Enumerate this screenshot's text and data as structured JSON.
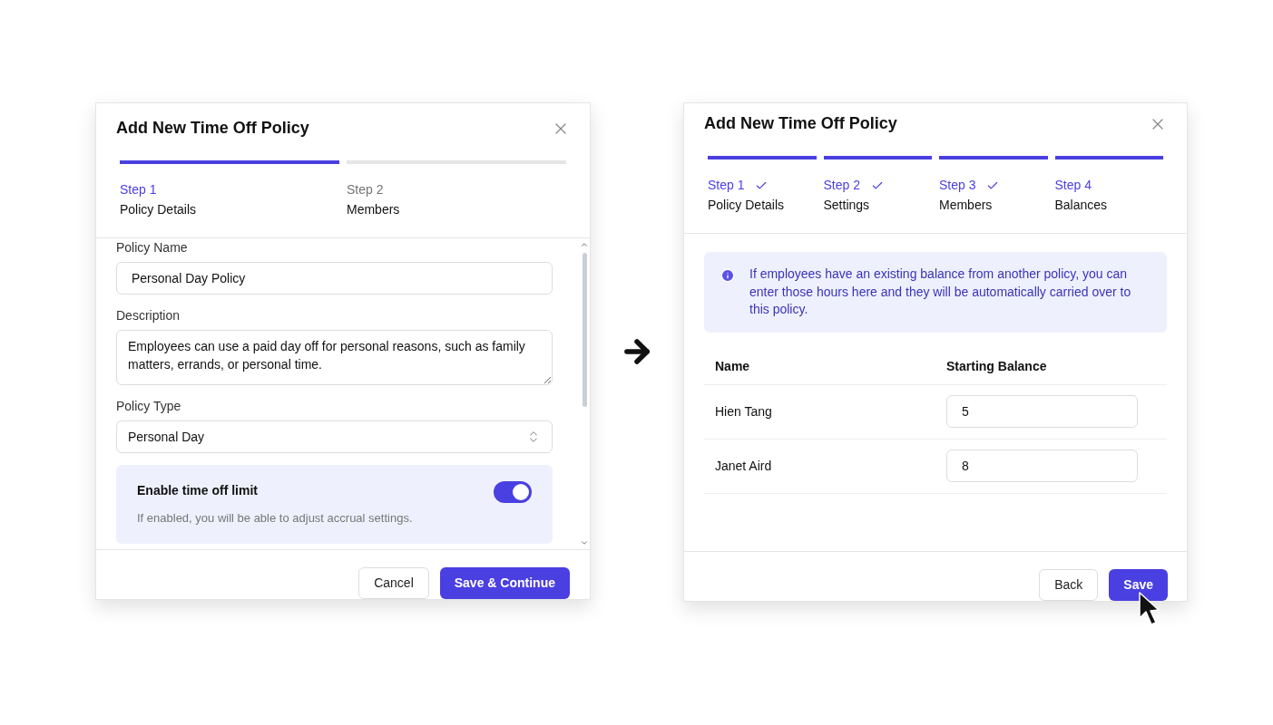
{
  "dialogs": [
    {
      "title": "Add New Time Off Policy",
      "steps": [
        {
          "label": "Step 1",
          "name": "Policy Details",
          "active": true,
          "completed": false
        },
        {
          "label": "Step 2",
          "name": "Members",
          "active": false,
          "completed": false
        }
      ],
      "fields": [
        {
          "kind": "text",
          "label": "Policy Name",
          "value": "Personal Day Policy"
        },
        {
          "kind": "textarea",
          "label": "Description",
          "value": "Employees can use a paid day off for personal reasons, such as family matters, errands, or personal time."
        },
        {
          "kind": "select",
          "label": "Policy Type",
          "value": "Personal Day"
        }
      ],
      "toggle_card": {
        "title": "Enable time off limit",
        "hint": "If enabled, you will be able to adjust accrual settings.",
        "on": true
      },
      "buttons": [
        {
          "kind": "secondary",
          "label": "Cancel"
        },
        {
          "kind": "primary",
          "label": "Save & Continue"
        }
      ]
    },
    {
      "title": "Add New Time Off Policy",
      "steps": [
        {
          "label": "Step 1",
          "name": "Policy Details",
          "active": true,
          "completed": true
        },
        {
          "label": "Step 2",
          "name": "Settings",
          "active": true,
          "completed": true
        },
        {
          "label": "Step 3",
          "name": "Members",
          "active": true,
          "completed": true
        },
        {
          "label": "Step 4",
          "name": "Balances",
          "active": true,
          "completed": false
        }
      ],
      "info": "If employees have an existing balance from another policy, you can enter those hours here and they will be automatically carried over to this policy.",
      "table": {
        "columns": [
          "Name",
          "Starting Balance"
        ],
        "rows": [
          {
            "name": "Hien Tang",
            "value": "5"
          },
          {
            "name": "Janet Aird",
            "value": "8"
          }
        ]
      },
      "buttons": [
        {
          "kind": "secondary",
          "label": "Back"
        },
        {
          "kind": "primary",
          "label": "Save"
        }
      ]
    }
  ]
}
